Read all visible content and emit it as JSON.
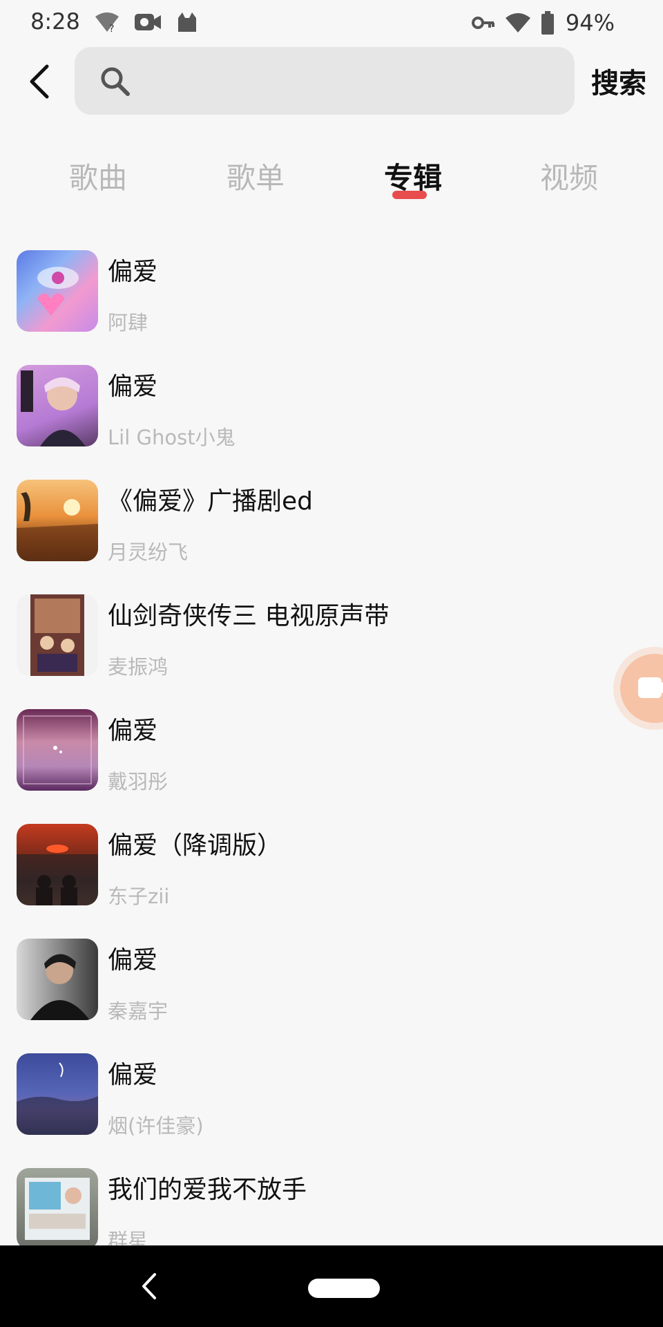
{
  "status_bar": {
    "time": "8:28",
    "battery": "94%"
  },
  "search": {
    "placeholder": "",
    "button_label": "搜索"
  },
  "tabs": [
    {
      "label": "歌曲",
      "active": false
    },
    {
      "label": "歌单",
      "active": false
    },
    {
      "label": "专辑",
      "active": true
    },
    {
      "label": "视频",
      "active": false
    }
  ],
  "albums": [
    {
      "title": "偏爱",
      "artist": "阿肆"
    },
    {
      "title": "偏爱",
      "artist": "Lil Ghost小鬼"
    },
    {
      "title": "《偏爱》广播剧ed",
      "artist": "月灵纷飞"
    },
    {
      "title": "仙剑奇侠传三 电视原声带",
      "artist": "麦振鸿"
    },
    {
      "title": "偏爱",
      "artist": "戴羽彤"
    },
    {
      "title": "偏爱（降调版）",
      "artist": "东子zii"
    },
    {
      "title": "偏爱",
      "artist": "秦嘉宇"
    },
    {
      "title": "偏爱",
      "artist": "烟(许佳豪)"
    },
    {
      "title": "我们的爱我不放手",
      "artist": "群星"
    }
  ],
  "colors": {
    "accent": "#e84d4d",
    "background": "#f7f7f7",
    "inactive_tab": "#b8b8b8"
  },
  "icons": {
    "back": "chevron-left-icon",
    "search": "search-icon",
    "float": "video-camera-icon"
  }
}
